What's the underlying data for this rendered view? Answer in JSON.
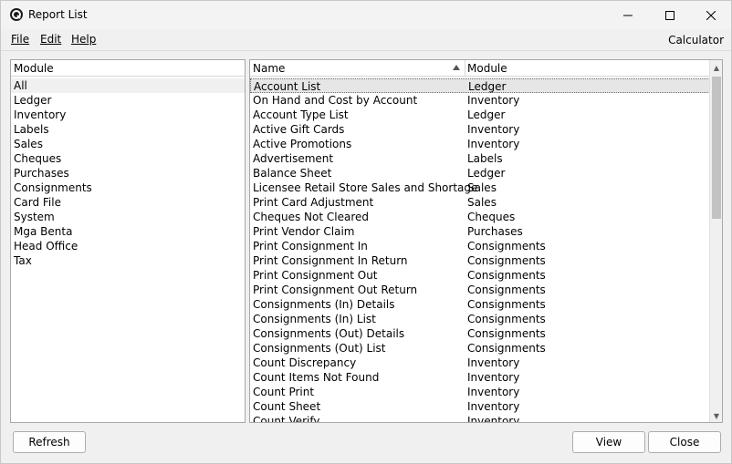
{
  "window": {
    "title": "Report List"
  },
  "menu": {
    "file": "File",
    "edit": "Edit",
    "help": "Help",
    "calculator": "Calculator"
  },
  "left_panel": {
    "header": "Module",
    "items": [
      "All",
      "Ledger",
      "Inventory",
      "Labels",
      "Sales",
      "Cheques",
      "Purchases",
      "Consignments",
      "Card File",
      "System",
      "Mga Benta",
      "Head Office",
      "Tax"
    ],
    "selected": "All"
  },
  "right_panel": {
    "columns": {
      "name": "Name",
      "module": "Module"
    },
    "sort": "name-ascending",
    "rows": [
      {
        "name": "Account List",
        "module": "Ledger"
      },
      {
        "name": "On Hand and Cost by Account",
        "module": "Inventory"
      },
      {
        "name": "Account Type List",
        "module": "Ledger"
      },
      {
        "name": "Active Gift Cards",
        "module": "Inventory"
      },
      {
        "name": "Active Promotions",
        "module": "Inventory"
      },
      {
        "name": "Advertisement",
        "module": "Labels"
      },
      {
        "name": "Balance Sheet",
        "module": "Ledger"
      },
      {
        "name": "Licensee Retail Store Sales and Shortage",
        "module": "Sales"
      },
      {
        "name": "Print Card Adjustment",
        "module": "Sales"
      },
      {
        "name": "Cheques Not Cleared",
        "module": "Cheques"
      },
      {
        "name": "Print Vendor Claim",
        "module": "Purchases"
      },
      {
        "name": "Print Consignment In",
        "module": "Consignments"
      },
      {
        "name": "Print Consignment In Return",
        "module": "Consignments"
      },
      {
        "name": "Print Consignment Out",
        "module": "Consignments"
      },
      {
        "name": "Print Consignment Out Return",
        "module": "Consignments"
      },
      {
        "name": "Consignments (In) Details",
        "module": "Consignments"
      },
      {
        "name": "Consignments (In) List",
        "module": "Consignments"
      },
      {
        "name": "Consignments (Out) Details",
        "module": "Consignments"
      },
      {
        "name": "Consignments (Out) List",
        "module": "Consignments"
      },
      {
        "name": "Count Discrepancy",
        "module": "Inventory"
      },
      {
        "name": "Count Items Not Found",
        "module": "Inventory"
      },
      {
        "name": "Count Print",
        "module": "Inventory"
      },
      {
        "name": "Count Sheet",
        "module": "Inventory"
      },
      {
        "name": "Count Verify",
        "module": "Inventory"
      }
    ],
    "selected_index": 0
  },
  "buttons": {
    "refresh": "Refresh",
    "view": "View",
    "close": "Close"
  },
  "icons": {
    "app": "report-app-icon",
    "minimize": "minimize-icon",
    "maximize": "maximize-icon",
    "close": "close-icon"
  }
}
